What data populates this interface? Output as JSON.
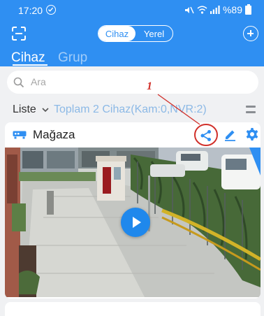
{
  "status_bar": {
    "time": "17:20",
    "battery": "%89"
  },
  "segment": {
    "options": [
      "Cihaz",
      "Yerel"
    ],
    "active": 0
  },
  "tabs": {
    "device": "Cihaz",
    "group": "Grup"
  },
  "search": {
    "placeholder": "Ara"
  },
  "list": {
    "label": "Liste",
    "summary": "Toplam 2 Cihaz(Kam:0,NVR:2)"
  },
  "device_card": {
    "title": "Mağaza"
  },
  "annotation": {
    "number": "1",
    "color": "#d1302a"
  },
  "colors": {
    "accent": "#2f8ff2",
    "play": "#1f88ec"
  },
  "icons": [
    "scan-icon",
    "add-icon",
    "search-icon",
    "chevron-down-icon",
    "menu-icon",
    "nvr-icon",
    "share-icon",
    "edit-icon",
    "gear-icon",
    "play-icon"
  ]
}
